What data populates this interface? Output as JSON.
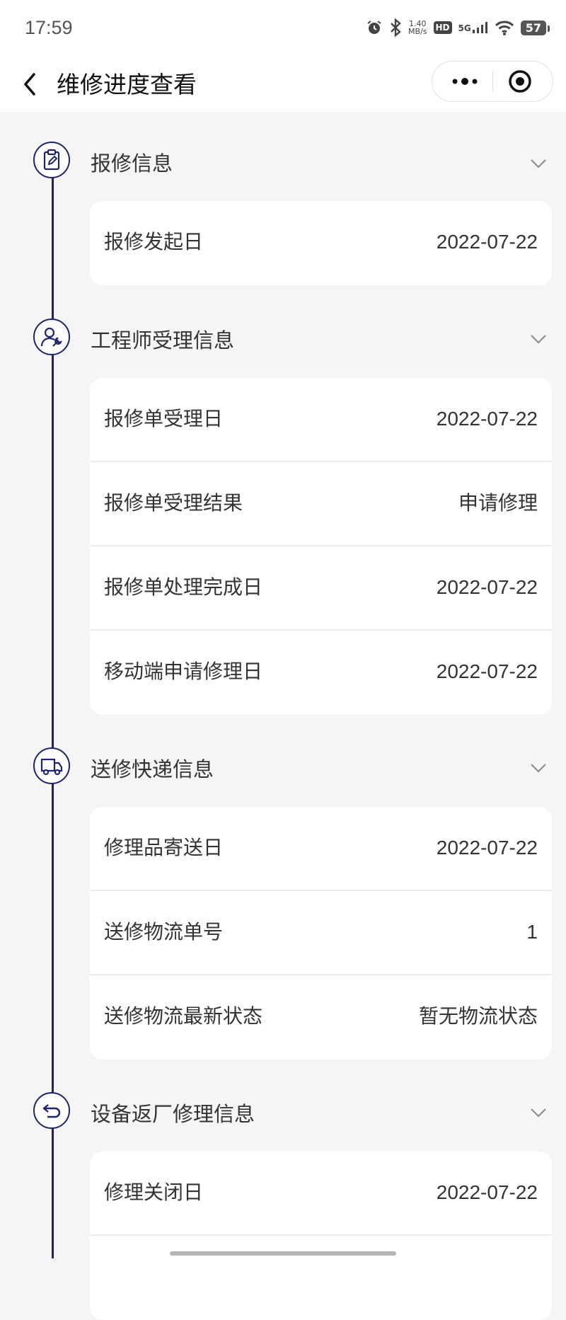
{
  "status_bar": {
    "time": "17:59",
    "net_speed_top": "1.40",
    "net_speed_unit": "MB/s",
    "hd": "HD",
    "network": "5G",
    "battery": "57"
  },
  "nav": {
    "title": "维修进度查看"
  },
  "sections": [
    {
      "title": "报修信息",
      "icon": "clipboard-edit-icon",
      "rows": [
        {
          "label": "报修发起日",
          "value": "2022-07-22"
        }
      ]
    },
    {
      "title": "工程师受理信息",
      "icon": "engineer-wrench-icon",
      "rows": [
        {
          "label": "报修单受理日",
          "value": "2022-07-22"
        },
        {
          "label": "报修单受理结果",
          "value": "申请修理"
        },
        {
          "label": "报修单处理完成日",
          "value": "2022-07-22"
        },
        {
          "label": "移动端申请修理日",
          "value": "2022-07-22"
        }
      ]
    },
    {
      "title": "送修快递信息",
      "icon": "delivery-truck-icon",
      "rows": [
        {
          "label": "修理品寄送日",
          "value": "2022-07-22"
        },
        {
          "label": "送修物流单号",
          "value": "1"
        },
        {
          "label": "送修物流最新状态",
          "value": "暂无物流状态"
        }
      ]
    },
    {
      "title": "设备返厂修理信息",
      "icon": "return-arrow-icon",
      "rows": [
        {
          "label": "修理关闭日",
          "value": "2022-07-22"
        },
        {
          "label": "",
          "value": ""
        }
      ]
    }
  ],
  "colors": {
    "accent": "#1f2466",
    "background": "#f5f5f5",
    "card": "#ffffff"
  }
}
